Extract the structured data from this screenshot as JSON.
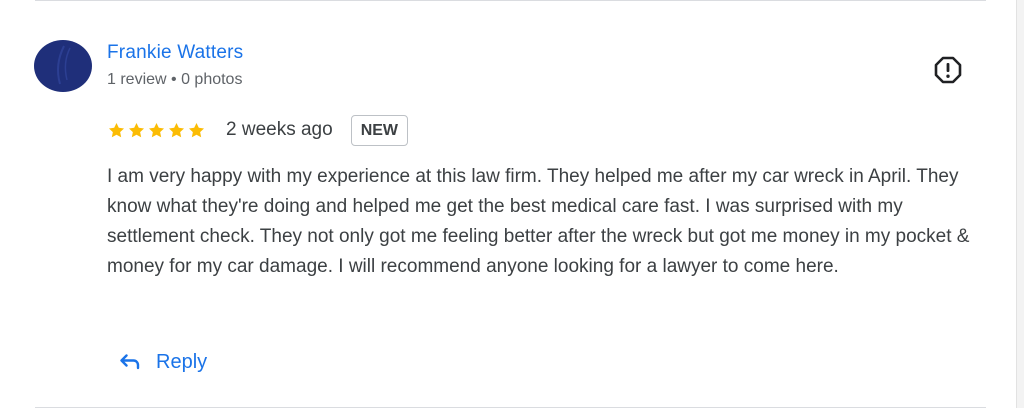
{
  "review": {
    "author": {
      "name": "Frankie Watters",
      "meta": "1 review • 0 photos"
    },
    "rating": 5,
    "rating_max": 5,
    "date": "2 weeks ago",
    "badge": "NEW",
    "text": "I am very happy with my experience at this law firm. They helped me after my car wreck in April. They know what they're doing and helped me get the best medical care fast. I was surprised with my settlement check. They not only got me feeling better after the wreck but got me money in my pocket & money for my car damage. I will recommend anyone looking for a lawyer to come here.",
    "reply_label": "Reply"
  },
  "colors": {
    "link": "#1a73e8",
    "star": "#fbbc04",
    "avatar": "#1f2f7a",
    "text": "#3c4043",
    "secondary_text": "#5f6368"
  },
  "icons": {
    "flag": "report-flag-icon",
    "reply": "reply-arrow-icon",
    "star": "star-icon"
  }
}
